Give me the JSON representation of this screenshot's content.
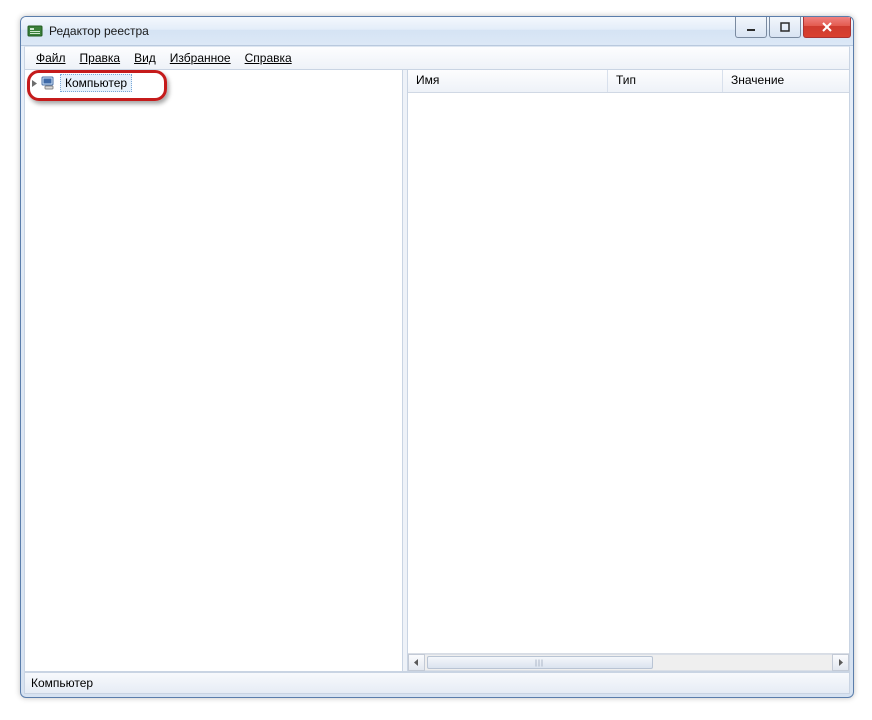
{
  "window": {
    "title": "Редактор реестра"
  },
  "menu": {
    "file": "Файл",
    "edit": "Правка",
    "view": "Вид",
    "fav": "Избранное",
    "help": "Справка"
  },
  "tree": {
    "root_label": "Компьютер"
  },
  "list": {
    "columns": {
      "name": "Имя",
      "type": "Тип",
      "value": "Значение"
    }
  },
  "statusbar": {
    "path": "Компьютер"
  }
}
